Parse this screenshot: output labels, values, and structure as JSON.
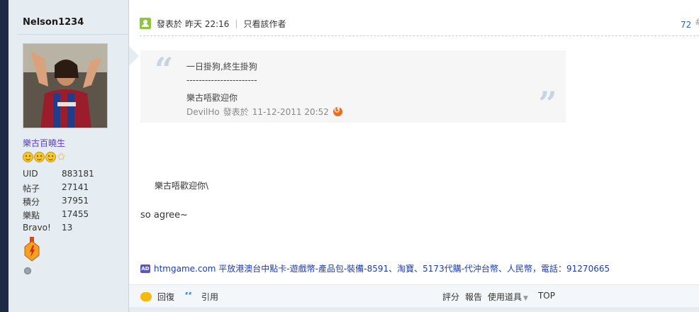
{
  "author": {
    "username": "Nelson1234",
    "rank": "樂古百曉生",
    "stats": [
      {
        "key": "UID",
        "value": "883181"
      },
      {
        "key": "帖子",
        "value": "27141"
      },
      {
        "key": "積分",
        "value": "37951"
      },
      {
        "key": "樂點",
        "value": "17455"
      },
      {
        "key": "Bravo!",
        "value": "13"
      }
    ],
    "star_icons": [
      "smiley-icon",
      "smiley-icon",
      "smiley-icon",
      "star-icon"
    ]
  },
  "post": {
    "posted_label": "發表於",
    "posted_time": "昨天 22:16",
    "separator": "|",
    "author_only": "只看該作者",
    "floor": "72",
    "floor_suffix": "#"
  },
  "quote": {
    "lines": [
      "一日掛狗,終生掛狗",
      "-----------------------",
      "樂古唔歡迎你"
    ],
    "meta_author": "DevilHo",
    "meta_label": "發表於",
    "meta_time": "11-12-2011 20:52"
  },
  "message": {
    "line1": "樂古唔歡迎你\\",
    "line2": "so  agree~"
  },
  "ad": {
    "badge": "AD",
    "text": "htmgame.com 平放港澳台中點卡-遊戲幣-產品包-裝備-8591、淘寶、5173代購-代沖台幣、人民幣，電話：91270665"
  },
  "footer": {
    "reply": "回復",
    "quote": "引用",
    "rate": "評分",
    "report": "報告",
    "tools": "使用道具",
    "top": "TOP"
  },
  "colors": {
    "sidebar_bg": "#e5edf2",
    "rank_color": "#5b3cc4",
    "link_blue": "#1c3dab",
    "floor_blue": "#336699"
  }
}
